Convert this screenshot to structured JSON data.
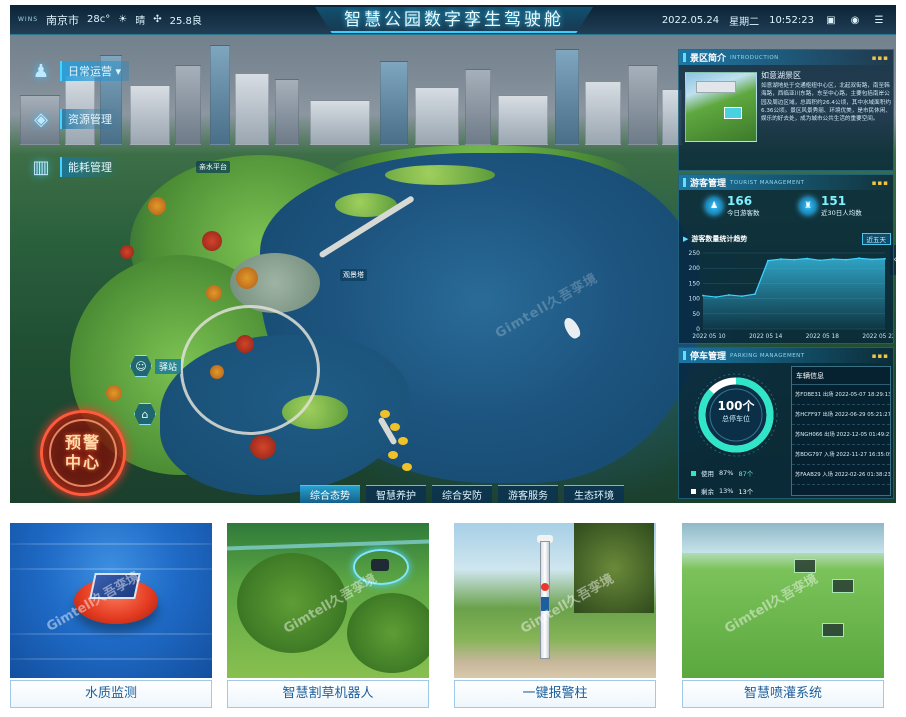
{
  "topbar": {
    "brand": "WINS",
    "city": "南京市",
    "temperature": "28c°",
    "weather": "晴",
    "aqi": "25.8良",
    "title": "智慧公园数字孪生驾驶舱",
    "date": "2022.05.24",
    "weekday": "星期二",
    "time": "10:52:23"
  },
  "left_menu": [
    {
      "label": "日常运营 ▾",
      "icon": "person-icon",
      "active": true
    },
    {
      "label": "资源管理",
      "icon": "layers-icon",
      "active": false
    },
    {
      "label": "能耗管理",
      "icon": "building-icon",
      "active": false
    }
  ],
  "map": {
    "poi_1": "亲水平台",
    "poi_2": "观景塔",
    "marker_1": "驿站",
    "watermark": "Gimtell久吾孪境"
  },
  "warning_center": {
    "line1": "预警",
    "line2": "中心"
  },
  "bottom_nav": [
    {
      "label": "综合态势",
      "active": true
    },
    {
      "label": "智慧养护",
      "active": false
    },
    {
      "label": "综合安防",
      "active": false
    },
    {
      "label": "游客服务",
      "active": false
    },
    {
      "label": "生态环境",
      "active": false
    }
  ],
  "intro": {
    "title": "景区简介",
    "subtitle": "INTRODUCTION",
    "name": "如意湖景区",
    "text": "如意湖地处于交通枢纽中心区，北起双街路，南至韩海路，西临亚川东路，东至中心路，主要包括南岸公园及周边区域，总面积约26.4公顷，其中水域面积约6.36公顷。景区风景秀丽、环境优美，是市民休闲、娱乐的好去处，成为城市公共生活的重要空间。"
  },
  "tourist": {
    "title": "游客管理",
    "subtitle": "TOURIST MANAGEMENT",
    "stat1_value": "166",
    "stat1_label": "今日游客数",
    "stat2_value": "151",
    "stat2_label": "近30日人均数",
    "trend_title": "游客数量统计趋势",
    "trend_button": "近五天"
  },
  "chart_data": {
    "type": "area",
    "title": "游客数量统计趋势",
    "x": [
      "2022 05 10",
      "2022 05 14",
      "2022 05 18",
      "2022 05 22"
    ],
    "y_ticks": [
      0,
      50,
      100,
      150,
      200,
      250
    ],
    "ylim": [
      0,
      250
    ],
    "series": [
      {
        "values": [
          110,
          105,
          112,
          108,
          115,
          225,
          230,
          228,
          232,
          226,
          230,
          228,
          233,
          229,
          231
        ]
      }
    ],
    "accent": "#3ed4ff"
  },
  "parking": {
    "title": "停车管理",
    "subtitle": "PARKING MANAGEMENT",
    "ring_value": "100个",
    "ring_label": "总停车位",
    "used_label": "使用",
    "used_pct": "87%",
    "used_count": "87个",
    "remain_label": "剩余",
    "remain_pct": "13%",
    "remain_count": "13个",
    "used_fraction": 0.87,
    "vehicle_title": "车辆信息",
    "vehicles": [
      "苏FDBE31 出场 2022-05-07 18:29:13",
      "苏HCFF97 出场 2022-06-29 05:21:27",
      "苏NGH066 出场 2022-12-05 01:49:23",
      "苏BDG797 入场 2022-11-27 16:35:05",
      "苏FAAB29 入场 2022-02-26 01:38:23"
    ]
  },
  "thumbnails": [
    {
      "caption": "水质监测",
      "watermark": "Gimtell久吾孪境"
    },
    {
      "caption": "智慧割草机器人",
      "watermark": "Gimtell久吾孪境"
    },
    {
      "caption": "一键报警柱",
      "watermark": "Gimtell久吾孪境"
    },
    {
      "caption": "智慧喷灌系统",
      "watermark": "Gimtell久吾孪境"
    }
  ]
}
